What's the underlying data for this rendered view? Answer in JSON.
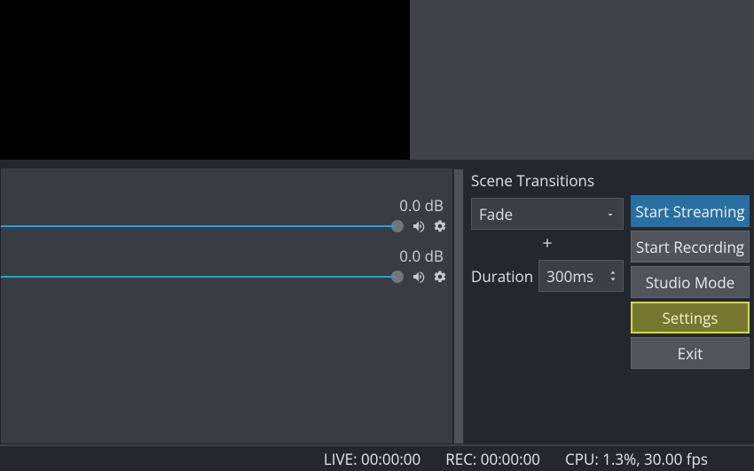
{
  "mixer": {
    "channels": [
      {
        "db": "0.0 dB"
      },
      {
        "db": "0.0 dB"
      }
    ]
  },
  "transitions": {
    "title": "Scene Transitions",
    "selected": "Fade",
    "duration_label": "Duration",
    "duration_value": "300ms"
  },
  "controls": {
    "start_streaming": "Start Streaming",
    "start_recording": "Start Recording",
    "studio_mode": "Studio Mode",
    "settings": "Settings",
    "exit": "Exit"
  },
  "status": {
    "live": "LIVE: 00:00:00",
    "rec": "REC: 00:00:00",
    "cpu": "CPU: 1.3%, 30.00 fps"
  }
}
